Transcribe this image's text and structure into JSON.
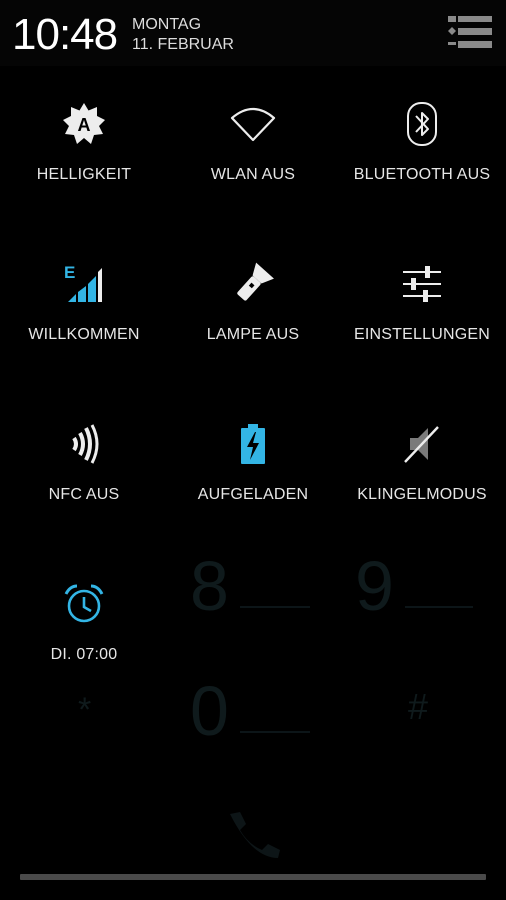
{
  "status": {
    "time": "10:48",
    "weekday": "MONTAG",
    "date": "11. FEBRUAR"
  },
  "tiles": [
    {
      "label": "HELLIGKEIT",
      "icon": "brightness-auto-icon"
    },
    {
      "label": "WLAN AUS",
      "icon": "wifi-icon"
    },
    {
      "label": "BLUETOOTH AUS",
      "icon": "bluetooth-icon"
    },
    {
      "label": "WILLKOMMEN",
      "icon": "mobile-signal-icon"
    },
    {
      "label": "LAMPE AUS",
      "icon": "flashlight-icon"
    },
    {
      "label": "EINSTELLUNGEN",
      "icon": "settings-sliders-icon"
    },
    {
      "label": "NFC AUS",
      "icon": "nfc-icon"
    },
    {
      "label": "AUFGELADEN",
      "icon": "battery-charging-icon"
    },
    {
      "label": "KLINGELMODUS",
      "icon": "ringer-muted-icon"
    },
    {
      "label": "DI. 07:00",
      "icon": "alarm-clock-icon"
    }
  ],
  "signal_letter": "E",
  "brightness_letter": "A",
  "colors": {
    "accent": "#33b5e5",
    "icon_white": "#ededed",
    "icon_grey": "#7a7a7a"
  }
}
